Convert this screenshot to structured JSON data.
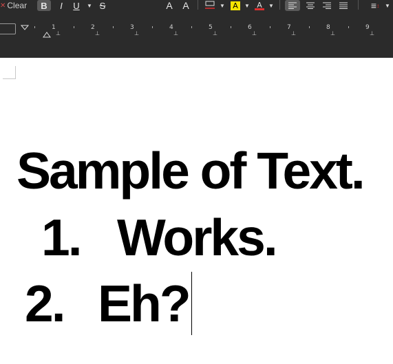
{
  "toolbar": {
    "clear_label": "Clear",
    "bold_glyph": "B",
    "italic_glyph": "I",
    "underline_glyph": "U",
    "strike_glyph": "S",
    "grow_glyph": "A",
    "shrink_glyph": "A",
    "list_glyph": "≡",
    "highlight_color": "#f5e400",
    "font_color": "#e03030"
  },
  "ruler": {
    "numbers": [
      "1",
      "2",
      "3",
      "4",
      "5",
      "6",
      "7",
      "8",
      "9"
    ]
  },
  "document": {
    "title": "Sample of Text.",
    "item1_marker": "1.",
    "item1_text": "Works.",
    "item2_marker": "2.",
    "item2_text": "Eh?"
  }
}
